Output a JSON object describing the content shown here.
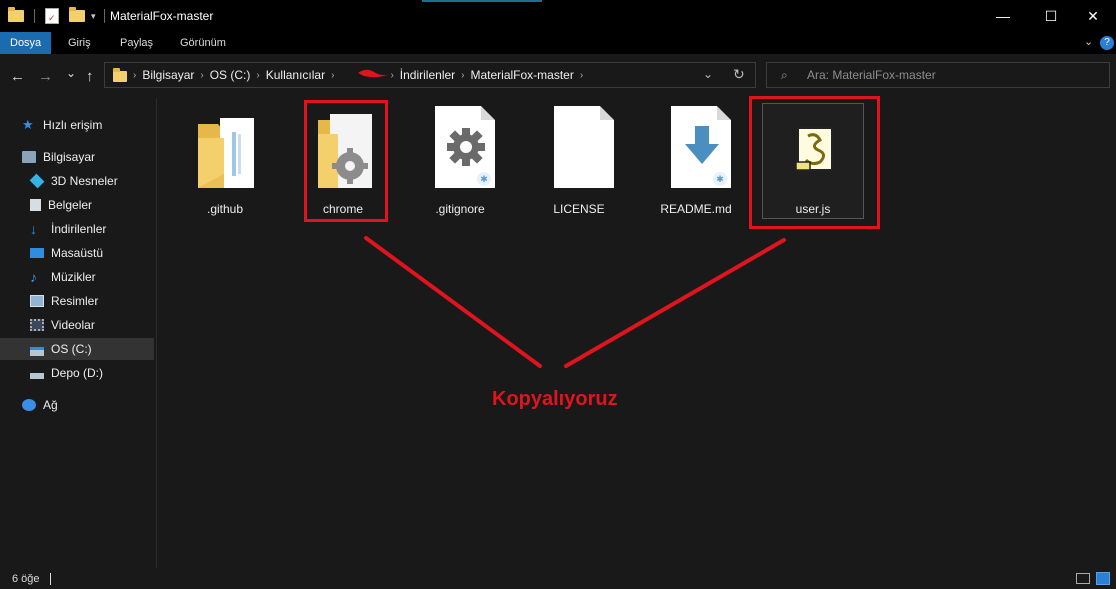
{
  "window": {
    "title": "MaterialFox-master",
    "controls": {
      "minimize": "—",
      "maximize": "☐",
      "close": "✕"
    }
  },
  "ribbon": {
    "tabs": [
      "Dosya",
      "Giriş",
      "Paylaş",
      "Görünüm"
    ],
    "expand_icon": "chevron-down-icon",
    "help": "?"
  },
  "nav": {
    "back": "←",
    "forward": "→",
    "recent": "⌄",
    "up": "↑",
    "breadcrumb": [
      "Bilgisayar",
      "OS (C:)",
      "Kullanıcılar",
      "•••n",
      "İndirilenler",
      "MaterialFox-master"
    ],
    "refresh": "↻",
    "search_placeholder": "Ara: MaterialFox-master"
  },
  "sidebar": {
    "items": [
      {
        "label": "Hızlı erişim",
        "icon": "star-icon",
        "color": "#3a8ee6"
      },
      {
        "label": "Bilgisayar",
        "icon": "computer-icon",
        "color": "#9fb7c8"
      },
      {
        "label": "3D Nesneler",
        "icon": "cube-3d-icon",
        "color": "#36b3e6"
      },
      {
        "label": "Belgeler",
        "icon": "documents-icon",
        "color": "#cfd8e0"
      },
      {
        "label": "İndirilenler",
        "icon": "download-arrow-icon",
        "color": "#2d8ee0"
      },
      {
        "label": "Masaüstü",
        "icon": "desktop-icon",
        "color": "#2d8ee0"
      },
      {
        "label": "Müzikler",
        "icon": "music-note-icon",
        "color": "#3a9ae6"
      },
      {
        "label": "Resimler",
        "icon": "pictures-icon",
        "color": "#8fb5d3"
      },
      {
        "label": "Videolar",
        "icon": "film-icon",
        "color": "#6f7f8f"
      },
      {
        "label": "OS (C:)",
        "icon": "drive-os-icon",
        "color": "#b9c5cf"
      },
      {
        "label": "Depo (D:)",
        "icon": "drive-icon",
        "color": "#b9c5cf"
      },
      {
        "label": "Ağ",
        "icon": "network-icon",
        "color": "#3a8ee6"
      }
    ]
  },
  "files": [
    {
      "label": ".github",
      "icon": "folder-icon"
    },
    {
      "label": "chrome",
      "icon": "folder-gear-icon"
    },
    {
      "label": ".gitignore",
      "icon": "gear-file-icon"
    },
    {
      "label": "LICENSE",
      "icon": "blank-file-icon"
    },
    {
      "label": "README.md",
      "icon": "download-file-icon"
    },
    {
      "label": "user.js",
      "icon": "script-file-icon"
    }
  ],
  "annotation": {
    "text": "Kopyalıyoruz",
    "color": "#e0141e"
  },
  "status": {
    "item_count": "6 öğe"
  }
}
